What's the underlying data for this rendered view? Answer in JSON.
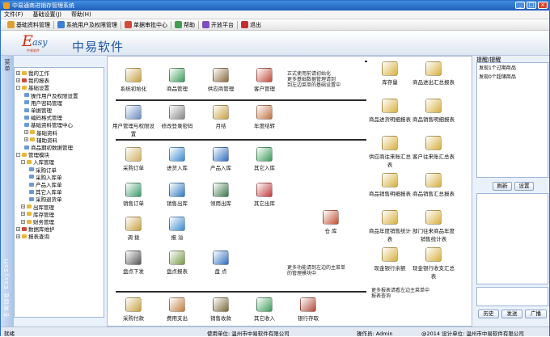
{
  "window": {
    "title": "中易通商进销存管理系统"
  },
  "menu": [
    "文件(F)",
    "基础设置(J)",
    "帮助(H)"
  ],
  "toolbar": [
    {
      "label": "基础资料管理",
      "color": "#e0a030"
    },
    {
      "label": "系统用户及权限管理",
      "color": "#3d7fd0"
    },
    {
      "label": "单据审批中心",
      "color": "#d44a3a"
    },
    {
      "label": "帮助",
      "color": "#40a050"
    },
    {
      "label": "开放平台",
      "color": "#7a50c0"
    },
    {
      "label": "退出",
      "color": "#c03030"
    }
  ],
  "banner": {
    "logo_e": "E",
    "logo_rest": "asy",
    "logo_sub": "中易软件",
    "brand": "中易软件"
  },
  "left_strip": {
    "tab": "菜单",
    "vertical": "中易软件 EasySoft"
  },
  "tree": [
    {
      "label": "我的工作",
      "expander": "+",
      "icon": "folder"
    },
    {
      "label": "我的报表",
      "expander": "+",
      "icon": "red"
    },
    {
      "label": "基础设置",
      "expander": "-",
      "icon": "folder"
    },
    {
      "label": "操作用户及权限设置",
      "expander": "",
      "icon": "doc"
    },
    {
      "label": "用户密码管理",
      "expander": "",
      "icon": "doc"
    },
    {
      "label": "单据管理",
      "expander": "",
      "icon": "doc"
    },
    {
      "label": "编码格式管理",
      "expander": "",
      "icon": "doc"
    },
    {
      "label": "基础资料管理中心",
      "expander": "",
      "icon": "doc"
    },
    {
      "label": "基础资料",
      "expander": "+",
      "icon": "folder"
    },
    {
      "label": "辅助资料",
      "expander": "+",
      "icon": "folder"
    },
    {
      "label": "商品期初数据管理",
      "expander": "",
      "icon": "doc"
    },
    {
      "label": "管理模块",
      "expander": "-",
      "icon": "folder"
    },
    {
      "label": "入库管理",
      "expander": "-",
      "icon": "folder"
    },
    {
      "label": "采购订单",
      "expander": "",
      "icon": "doc"
    },
    {
      "label": "采购入库单",
      "expander": "",
      "icon": "doc"
    },
    {
      "label": "产品入库单",
      "expander": "",
      "icon": "doc"
    },
    {
      "label": "其它入库单",
      "expander": "",
      "icon": "doc"
    },
    {
      "label": "采购退货单",
      "expander": "",
      "icon": "doc"
    },
    {
      "label": "出库管理",
      "expander": "+",
      "icon": "folder"
    },
    {
      "label": "库存管理",
      "expander": "+",
      "icon": "folder"
    },
    {
      "label": "财务管理",
      "expander": "+",
      "icon": "folder"
    },
    {
      "label": "数据库维护",
      "expander": "+",
      "icon": "red"
    },
    {
      "label": "报表查询",
      "expander": "+",
      "icon": "folder"
    }
  ],
  "main": {
    "section1": [
      {
        "label": "系统初始化",
        "color": "#c8a040"
      },
      {
        "label": "商品管理",
        "color": "#3a9c5a"
      },
      {
        "label": "供应商管理",
        "color": "#8a6a3a"
      },
      {
        "label": "客户管理",
        "color": "#c04a3a"
      }
    ],
    "section1_desc": "正式使用前请初始化\n更多基础数据管理请到\n到左边菜单的基础设置中",
    "section2": [
      {
        "label": "用户管理与权限设置",
        "color": "#6a8ac0"
      },
      {
        "label": "修改登录密码",
        "color": "#888888"
      },
      {
        "label": "月结",
        "color": "#c8a040"
      },
      {
        "label": "年度结转",
        "color": "#c07040"
      }
    ],
    "section3": [
      {
        "label": "采购订单",
        "color": "#d0b060"
      },
      {
        "label": "进货入库",
        "color": "#3a8ad0"
      },
      {
        "label": "产品入库",
        "color": "#2e6ec0"
      },
      {
        "label": "其它入库",
        "color": "#3a9a5a"
      },
      {
        "label": "销售订单",
        "color": "#3a9a6a"
      },
      {
        "label": "销售出库",
        "color": "#2e7ac0"
      },
      {
        "label": "领用出库",
        "color": "#3a7a4a"
      },
      {
        "label": "其它出库",
        "color": "#c03a3a"
      },
      {
        "label": "调 拨",
        "color": "#c8a040"
      },
      {
        "label": "报 溢",
        "color": "#3a8ad0"
      },
      {
        "label": "仓 库",
        "color": "#c05030"
      },
      {
        "label": "盘点下发",
        "color": "#555555"
      },
      {
        "label": "盘点报表",
        "color": "#7a9a4a"
      },
      {
        "label": "盘 点",
        "color": "#2e6ec0"
      }
    ],
    "section3_desc": "更多功能请到左边的主菜单\n的管理模块中",
    "section4": [
      {
        "label": "采购付款",
        "color": "#c8a040"
      },
      {
        "label": "费用支出",
        "color": "#c08040"
      },
      {
        "label": "销售收款",
        "color": "#7a6a3a"
      },
      {
        "label": "其它收入",
        "color": "#3a9a5a"
      },
      {
        "label": "银行存取",
        "color": "#b04a3a"
      }
    ],
    "reports": [
      {
        "label": "库存量",
        "color": "#d8b040"
      },
      {
        "label": "商品进出汇总报表",
        "color": "#d8b040"
      },
      {
        "label": "商品进货明细报表",
        "color": "#d8b040"
      },
      {
        "label": "商品销售明细报表",
        "color": "#d8b040"
      },
      {
        "label": "供应商往来账汇总表",
        "color": "#d8b040"
      },
      {
        "label": "客户往来账汇总表",
        "color": "#d8b040"
      },
      {
        "label": "商品销售明细报表",
        "color": "#d8b040"
      },
      {
        "label": "商品销售汇总报表",
        "color": "#d8b040"
      },
      {
        "label": "商品年度销售统计表",
        "color": "#d8b040"
      },
      {
        "label": "部门往来商品年度销售统计表",
        "color": "#d8b040"
      },
      {
        "label": "现金银行余额",
        "color": "#d8b040"
      },
      {
        "label": "现金银行收支汇总表",
        "color": "#d8b040"
      }
    ],
    "reports_desc": "更多报表请看左边主菜单中\n报表查询"
  },
  "right_panel": {
    "header": "提醒/提醒",
    "messages": [
      "发现1个过期商品",
      "发现0个超储商品"
    ],
    "buttons_top": [
      "刷新",
      "设置"
    ],
    "buttons_bottom": [
      "历史",
      "发送",
      "广播"
    ]
  },
  "status": {
    "ready": "就绪",
    "company": "使用单位: 温州市中易软件有限公司",
    "operator": "操作员: Admin",
    "copyright": "@2014 设计单位: 温州市中易软件有限公司"
  }
}
